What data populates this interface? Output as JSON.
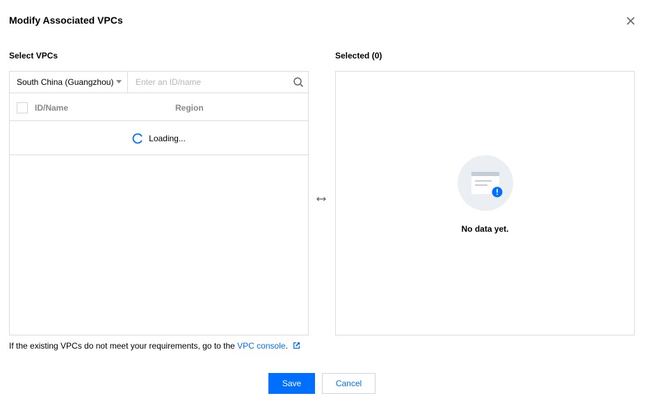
{
  "dialog": {
    "title": "Modify Associated VPCs",
    "close_icon": "close-icon"
  },
  "left": {
    "label": "Select VPCs",
    "region_select": {
      "value": "South China (Guangzhou)",
      "icon": "chevron-down-icon"
    },
    "search": {
      "placeholder": "Enter an ID/name",
      "value": "",
      "icon": "search-icon"
    },
    "columns": [
      "ID/Name",
      "Region"
    ],
    "loading_text": "Loading..."
  },
  "transfer_icon": "arrows-left-right-icon",
  "right": {
    "label": "Selected (0)",
    "empty_text": "No data yet.",
    "empty_icon": "empty-document-icon"
  },
  "footnote": {
    "text": "If the existing VPCs do not meet your requirements, go to the ",
    "link": "VPC console",
    "suffix": ".",
    "link_icon": "external-link-icon"
  },
  "buttons": {
    "save": "Save",
    "cancel": "Cancel"
  },
  "colors": {
    "primary": "#006eff",
    "border": "#dcdcdc",
    "muted_text": "#888888",
    "placeholder": "#b5b5b5",
    "empty_circle": "#ebeef2"
  }
}
